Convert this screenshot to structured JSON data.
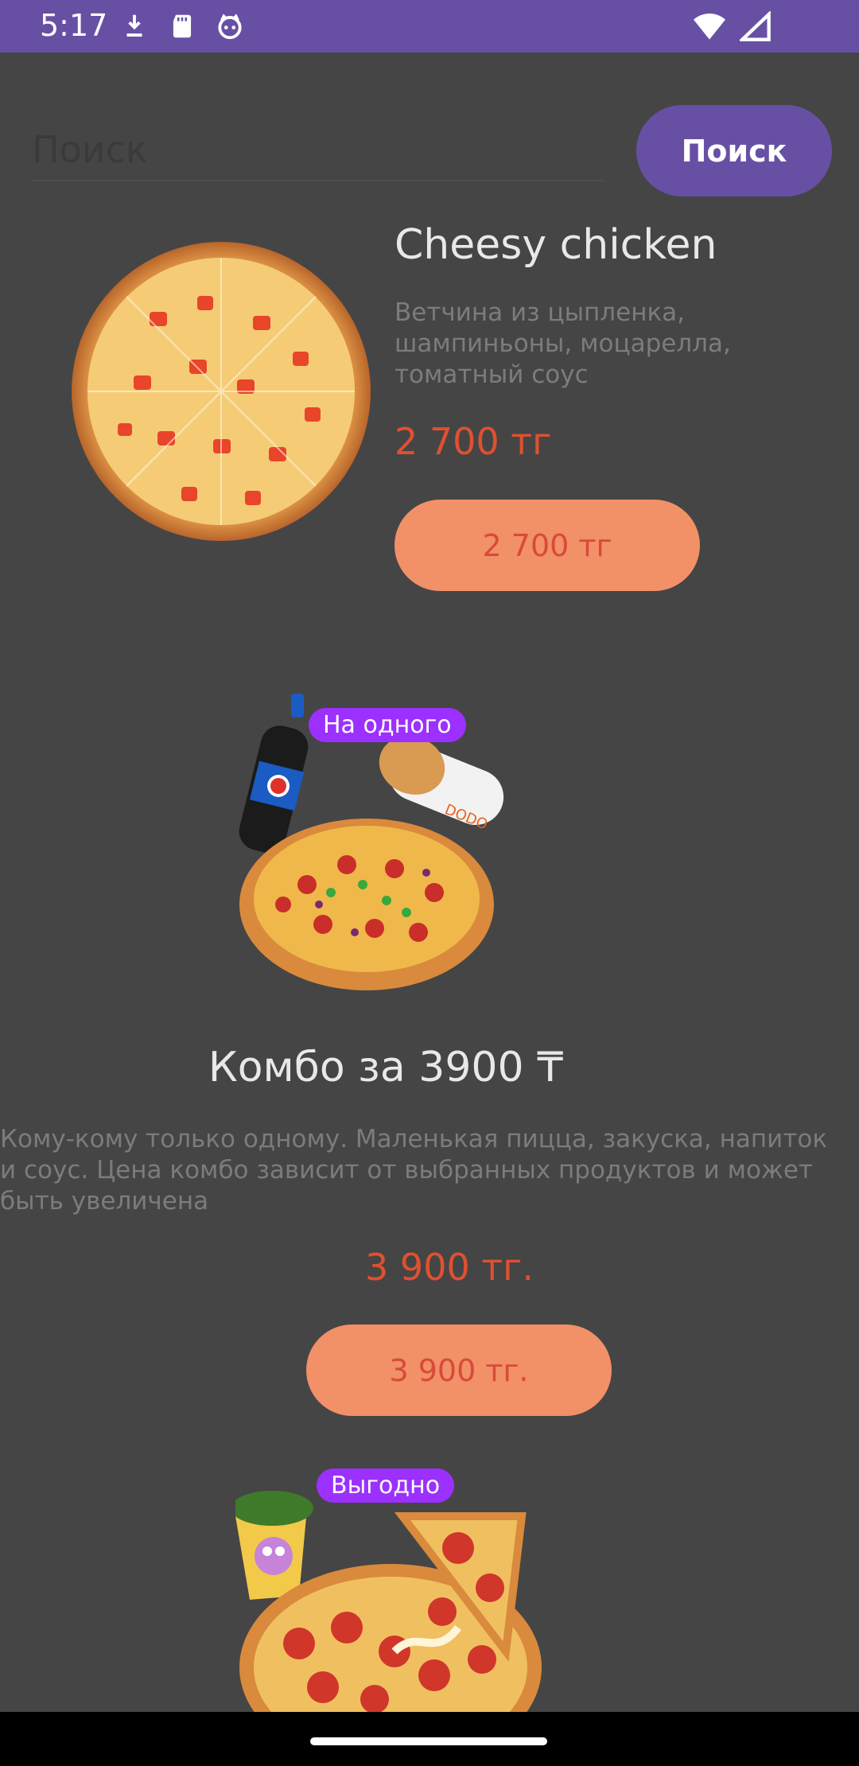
{
  "status_bar": {
    "time": "5:17",
    "left_icons": [
      "download-icon",
      "sd-card-icon",
      "cat-face-icon"
    ],
    "right_icons": [
      "wifi-icon",
      "signal-icon"
    ]
  },
  "search": {
    "placeholder": "Поиск",
    "button_label": "Поиск"
  },
  "products": [
    {
      "title": "Cheesy chicken",
      "description": "Ветчина из цыпленка, шампиньоны, моцарелла, томатный соус",
      "price": "2 700 тг",
      "button_label": "2 700 тг"
    },
    {
      "badge": "На одного",
      "title": "Комбо за 3900 ₸",
      "description": "Кому-кому только одному. Маленькая пицца, закуска, напиток и соус. Цена комбо зависит от выбранных продуктов и может быть увеличена",
      "price": "3 900 тг.",
      "button_label": "3 900 тг."
    },
    {
      "badge": "Выгодно"
    }
  ],
  "colors": {
    "accent": "#6750A4",
    "price_text": "#e05030",
    "buy_button": "#F29068",
    "badge": "#9b30ff",
    "background": "#454545"
  }
}
